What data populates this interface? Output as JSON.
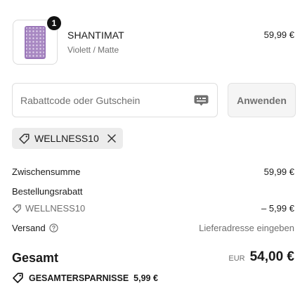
{
  "product": {
    "name": "SHANTIMAT",
    "variant": "Violett / Matte",
    "price": "59,99 €",
    "quantity": "1",
    "thumbnail_color": "#a888c2"
  },
  "discount": {
    "placeholder": "Rabattcode oder Gutschein",
    "value": "",
    "apply_label": "Anwenden",
    "applied_code": "WELLNESS10"
  },
  "summary": {
    "subtotal_label": "Zwischensumme",
    "subtotal_value": "59,99 €",
    "order_discount_label": "Bestellungsrabatt",
    "order_discount_code": "WELLNESS10",
    "order_discount_value": "– 5,99 €",
    "shipping_label": "Versand",
    "shipping_value": "Lieferadresse eingeben",
    "total_label": "Gesamt",
    "currency": "EUR",
    "total_value": "54,00 €",
    "savings_label": "GESAMTERSPARNISSE",
    "savings_value": "5,99 €"
  },
  "icons": {
    "tag": "tag-icon",
    "remove": "close-icon",
    "info": "help-circle-icon",
    "gift_card": "gift-card-icon"
  }
}
